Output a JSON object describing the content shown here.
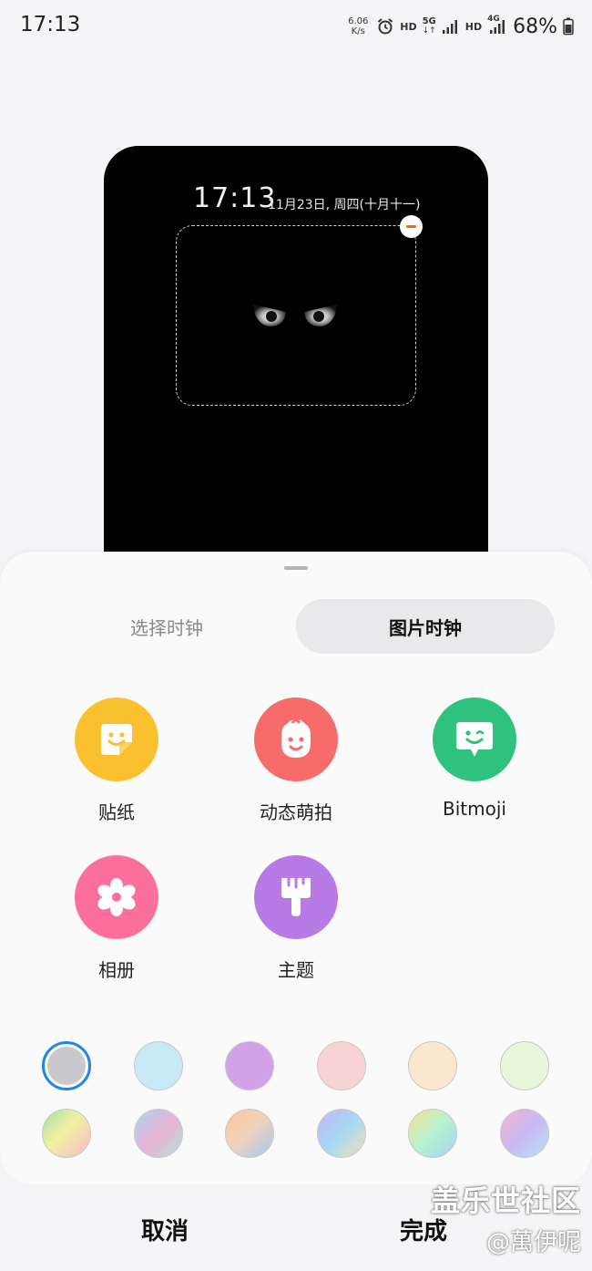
{
  "status_bar": {
    "time": "17:13",
    "net_speed_value": "6.06",
    "net_speed_unit": "K/s",
    "hd1": "HD",
    "network_5g": "5G",
    "hd2": "HD",
    "network_4g": "4G",
    "battery": "68%"
  },
  "preview": {
    "time": "17:13",
    "date": "11月23日, 周四(十月十一)"
  },
  "tabs": [
    {
      "label": "选择时钟",
      "selected": false
    },
    {
      "label": "图片时钟",
      "selected": true
    }
  ],
  "options": [
    {
      "label": "贴纸",
      "icon": "sticker-icon",
      "color": "#fbc02d"
    },
    {
      "label": "动态萌拍",
      "icon": "baby-face-icon",
      "color": "#f86b6b"
    },
    {
      "label": "Bitmoji",
      "icon": "bitmoji-icon",
      "color": "#2ec27e"
    },
    {
      "label": "相册",
      "icon": "flower-icon",
      "color": "#fb6f9c"
    },
    {
      "label": "主题",
      "icon": "paintbrush-icon",
      "color": "#b87be6"
    }
  ],
  "swatches": [
    {
      "name": "gray",
      "color": "#c9c9cb",
      "selected": true
    },
    {
      "name": "light-blue",
      "color": "#c9e8f8"
    },
    {
      "name": "lavender",
      "color": "#d2a2e8"
    },
    {
      "name": "pink",
      "color": "#f7d3d4"
    },
    {
      "name": "peach",
      "color": "#fbe7cd"
    },
    {
      "name": "mint",
      "color": "#e8f6da"
    },
    {
      "name": "gradient-1",
      "gradient": "linear-gradient(135deg,#9fe0a8,#f3f1a2 45%,#f5b9c8)"
    },
    {
      "name": "gradient-2",
      "gradient": "linear-gradient(135deg,#a9d6f0,#e8b2d6 50%,#b4e3d2)"
    },
    {
      "name": "gradient-3",
      "gradient": "linear-gradient(135deg,#f8c59e,#f1d3b8 45%,#a8c8f0)"
    },
    {
      "name": "gradient-4",
      "gradient": "linear-gradient(135deg,#c6b3f4,#a6d8f4 50%,#f4e0b8)"
    },
    {
      "name": "gradient-5",
      "gradient": "linear-gradient(135deg,#f6e38e,#b7f0d0 50%,#a8d2f4)"
    },
    {
      "name": "gradient-6",
      "gradient": "linear-gradient(135deg,#f4b6c8,#c9b8f4 50%,#b6e2f4)"
    }
  ],
  "actions": {
    "cancel": "取消",
    "done": "完成"
  },
  "watermark": {
    "line1": "盖乐世社区",
    "line2": "@萬伊呢"
  }
}
